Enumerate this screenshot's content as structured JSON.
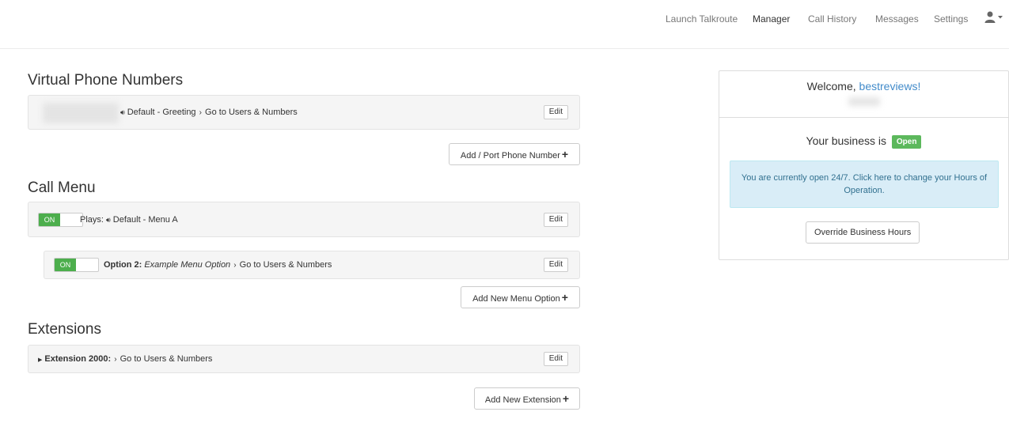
{
  "nav": {
    "items": [
      {
        "label": "Launch Talkroute"
      },
      {
        "label": "Manager"
      },
      {
        "label": "Call History"
      },
      {
        "label": "Messages"
      },
      {
        "label": "Settings"
      }
    ],
    "user_icon": "user-icon",
    "active": "Manager"
  },
  "virtual_numbers": {
    "title": "Virtual Phone Numbers",
    "row": {
      "speaker_icon": "speaker-icon",
      "greeting": "Default - Greeting",
      "arrow_icon": "chevron-right-icon",
      "destination": "Go to Users & Numbers",
      "edit_label": "Edit"
    },
    "add_label": "Add / Port Phone Number"
  },
  "call_menu": {
    "title": "Call Menu",
    "main_row": {
      "toggle_label": "ON",
      "plays_label": "Plays:",
      "speaker_icon": "speaker-icon",
      "menu": "Default - Menu A",
      "edit_label": "Edit"
    },
    "option_row": {
      "toggle_label": "ON",
      "option_label": "Option 2:",
      "option_name": "Example Menu Option",
      "destination": "Go to Users & Numbers",
      "edit_label": "Edit"
    },
    "add_label": "Add New Menu Option"
  },
  "extensions": {
    "title": "Extensions",
    "row": {
      "caret_icon": "caret-right-icon",
      "label": "Extension 2000:",
      "destination": "Go to Users & Numbers",
      "edit_label": "Edit"
    },
    "add_label": "Add New Extension"
  },
  "sidebar": {
    "welcome_prefix": "Welcome,",
    "username": "bestreviews!",
    "business_prefix": "Your business is",
    "status_badge": "Open",
    "hours_notice": "You are currently open 24/7. Click here to change your Hours of Operation.",
    "override_label": "Override Business Hours"
  },
  "colors": {
    "accent_link": "#428bca",
    "toggle_on": "#4cae4c",
    "open_badge": "#5cb85c",
    "info_bg": "#d9edf7",
    "info_text": "#31708f"
  }
}
